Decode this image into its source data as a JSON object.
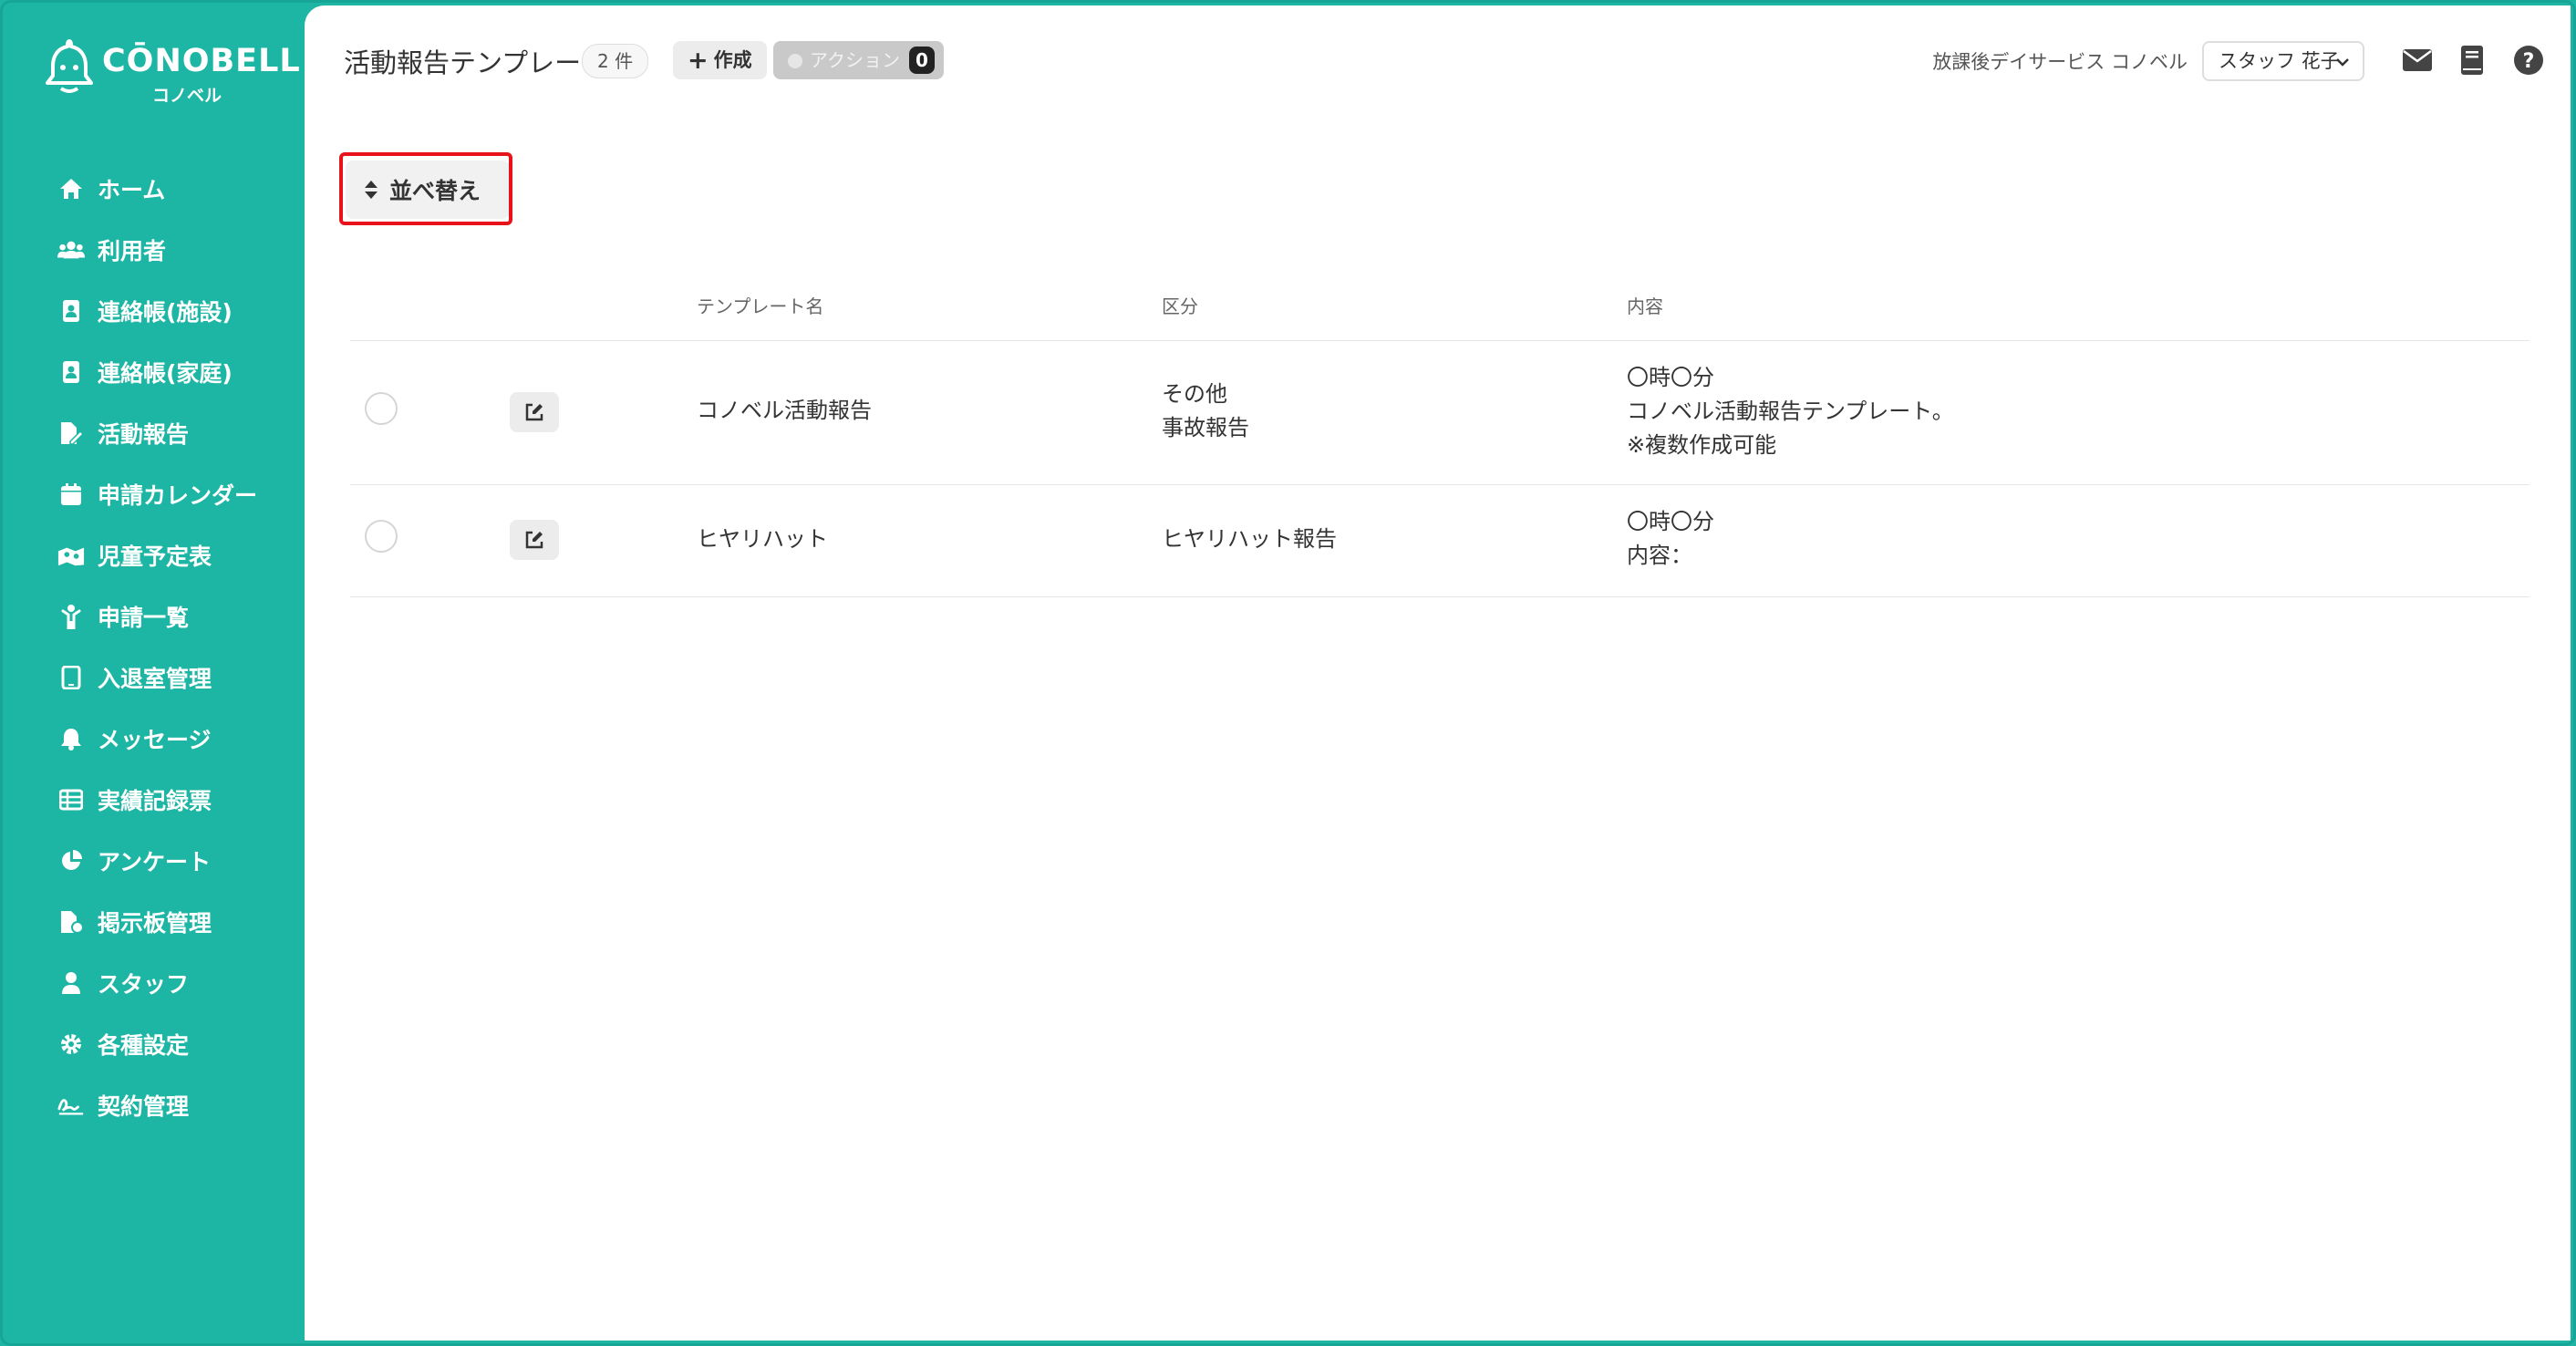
{
  "brand": {
    "name": "CŌNOBELL",
    "sub": "コノベル"
  },
  "sidebar": {
    "items": [
      {
        "label": "ホーム",
        "icon": "home-icon"
      },
      {
        "label": "利用者",
        "icon": "users-icon"
      },
      {
        "label": "連絡帳(施設)",
        "icon": "contact-book-icon"
      },
      {
        "label": "連絡帳(家庭)",
        "icon": "contact-book-icon"
      },
      {
        "label": "活動報告",
        "icon": "report-icon"
      },
      {
        "label": "申請カレンダー",
        "icon": "calendar-icon"
      },
      {
        "label": "児童予定表",
        "icon": "schedule-icon"
      },
      {
        "label": "申請一覧",
        "icon": "child-icon"
      },
      {
        "label": "入退室管理",
        "icon": "tablet-icon"
      },
      {
        "label": "メッセージ",
        "icon": "bell-icon"
      },
      {
        "label": "実績記録票",
        "icon": "table-icon"
      },
      {
        "label": "アンケート",
        "icon": "pie-chart-icon"
      },
      {
        "label": "掲示板管理",
        "icon": "board-icon"
      },
      {
        "label": "スタッフ",
        "icon": "staff-icon"
      },
      {
        "label": "各種設定",
        "icon": "gear-icon"
      },
      {
        "label": "契約管理",
        "icon": "signature-icon"
      }
    ]
  },
  "header": {
    "title": "活動報告テンプレート",
    "count": "2 件",
    "create_label": "作成",
    "action_label": "アクション",
    "action_count": "0",
    "facility": "放課後デイサービス コノベル",
    "staff": "スタッフ 花子"
  },
  "toolbar": {
    "sort_label": "並べ替え"
  },
  "table": {
    "headers": [
      "テンプレート名",
      "区分",
      "内容"
    ],
    "rows": [
      {
        "name": "コノベル活動報告",
        "category": [
          "その他",
          "事故報告"
        ],
        "content": [
          "〇時〇分",
          "コノベル活動報告テンプレート。",
          "※複数作成可能"
        ]
      },
      {
        "name": "ヒヤリハット",
        "category": [
          "ヒヤリハット報告"
        ],
        "content": [
          "〇時〇分",
          "内容："
        ]
      }
    ]
  },
  "colors": {
    "sidebar": "#1db5a3",
    "highlight": "#e8121a"
  }
}
